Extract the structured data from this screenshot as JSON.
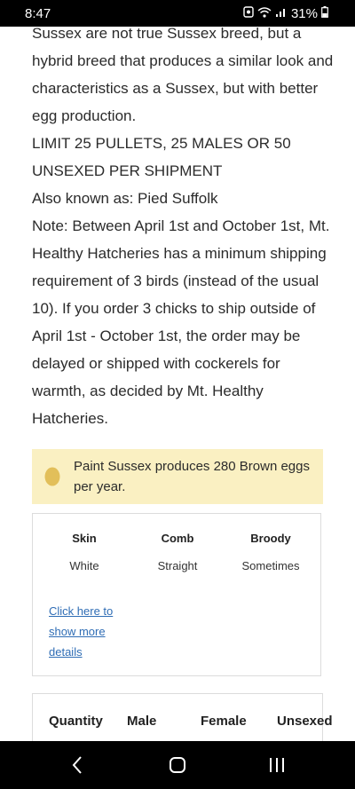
{
  "status_bar": {
    "time": "8:47",
    "battery": "31%",
    "icons": [
      "notification-icon",
      "wifi-icon",
      "signal-icon",
      "battery-icon"
    ]
  },
  "description": {
    "paragraphs": [
      "Sussex are not true Sussex breed, but a hybrid breed that produces a similar look and characteristics as a Sussex, but with better egg production.",
      "LIMIT 25 PULLETS, 25 MALES OR 50 UNSEXED PER SHIPMENT",
      "Also known as: Pied Suffolk",
      "Note: Between April 1st and October 1st, Mt. Healthy Hatcheries has a minimum shipping requirement of 3 birds (instead of the usual 10). If you order 3 chicks to ship outside of April 1st - October 1st, the order may be delayed or shipped with cockerels for warmth, as decided by Mt. Healthy Hatcheries."
    ]
  },
  "egg_note": {
    "text": "Paint Sussex produces 280 Brown eggs per year.",
    "icon": "egg-icon",
    "background": "#faf0c2"
  },
  "attributes": {
    "items": [
      {
        "label": "Skin",
        "value": "White"
      },
      {
        "label": "Comb",
        "value": "Straight"
      },
      {
        "label": "Broody",
        "value": "Sometimes"
      }
    ],
    "more_link": "Click here to show more details"
  },
  "quantity_table": {
    "headers": [
      "Quantity",
      "Male",
      "Female",
      "Unsexed"
    ]
  },
  "nav_bar": {
    "icons": [
      "back-icon",
      "home-icon",
      "recents-icon"
    ]
  },
  "colors": {
    "link": "#2f6db5",
    "egg": "#e2bf5a",
    "note_background": "#faf0c2"
  }
}
